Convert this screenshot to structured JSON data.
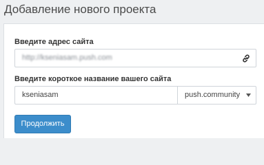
{
  "page": {
    "title": "Добавление нового проекта"
  },
  "form": {
    "url_label": "Введите адрес сайта",
    "url_value": "http://kseniasam.push.com",
    "name_label": "Введите короткое название вашего сайта",
    "name_value": "kseniasam",
    "domain_selected": "push.community",
    "submit_label": "Продолжить"
  },
  "icons": {
    "url_icon": "link-icon",
    "select_icon": "chevron-down-icon"
  },
  "colors": {
    "accent": "#3c8dcb",
    "background": "#eef0f2"
  }
}
